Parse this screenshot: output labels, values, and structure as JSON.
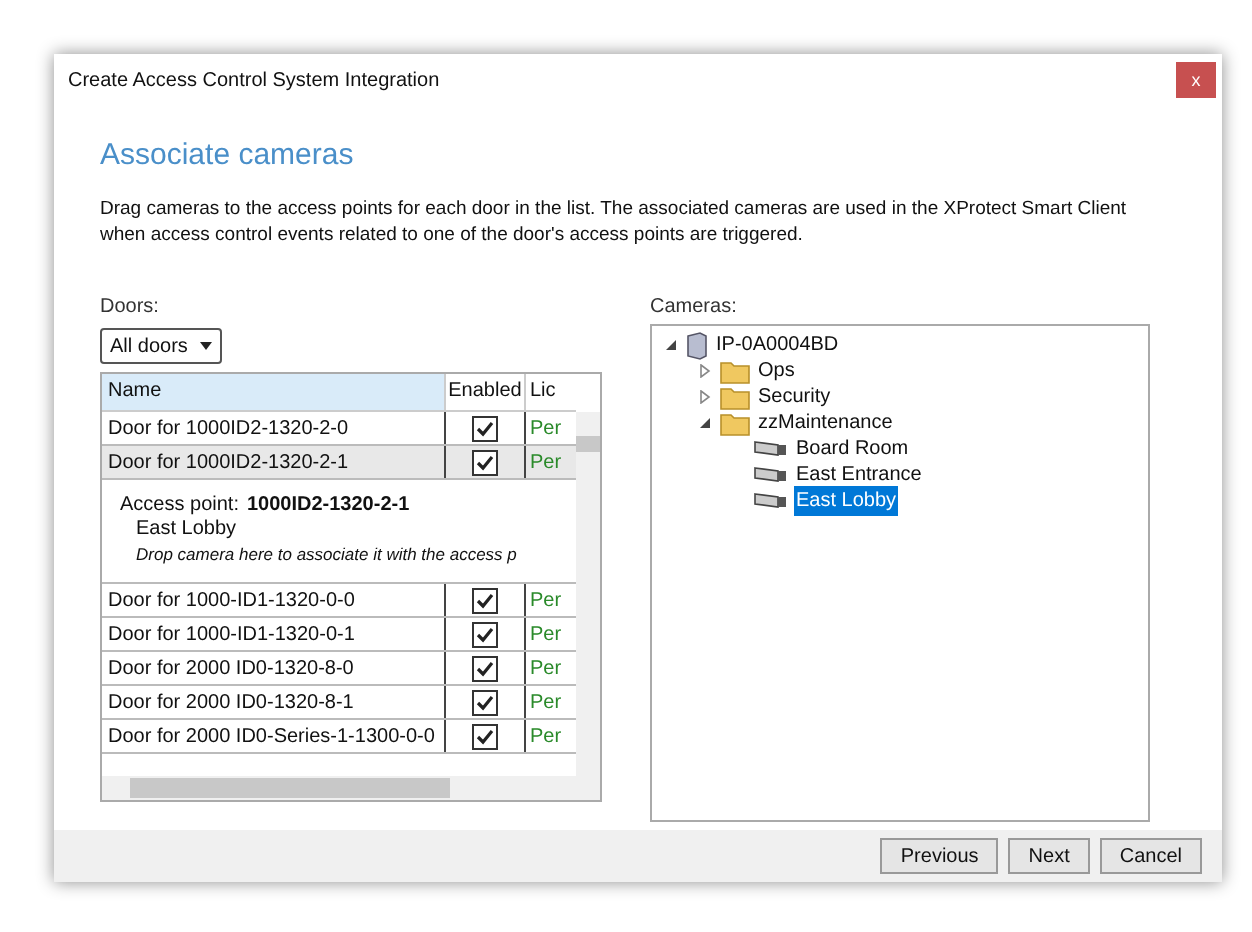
{
  "window": {
    "title": "Create Access Control System Integration",
    "close": "x"
  },
  "heading": "Associate cameras",
  "description": "Drag cameras to the access points for each door in the list. The associated cameras are used in the XProtect Smart Client when access control events related to one of the door's access points are triggered.",
  "doors": {
    "label": "Doors:",
    "filter": "All doors",
    "columns": [
      "Name",
      "Enabled",
      "Lic"
    ],
    "rows": [
      {
        "name": "Door for 1000ID2-1320-2-0",
        "enabled": true,
        "column_3": "Per",
        "selected": false
      },
      {
        "name": "Door for 1000ID2-1320-2-1",
        "enabled": true,
        "column_3": "Per",
        "selected": true,
        "detail": {
          "label": "Access point:",
          "access_point": "1000ID2-1320-2-1",
          "camera": "East Lobby",
          "hint": "Drop camera here to associate it with the access p"
        }
      },
      {
        "name": "Door for 1000-ID1-1320-0-0",
        "enabled": true,
        "column_3": "Per",
        "selected": false
      },
      {
        "name": "Door for 1000-ID1-1320-0-1",
        "enabled": true,
        "column_3": "Per",
        "selected": false
      },
      {
        "name": "Door for 2000 ID0-1320-8-0",
        "enabled": true,
        "column_3": "Per",
        "selected": false
      },
      {
        "name": "Door for 2000 ID0-1320-8-1",
        "enabled": true,
        "column_3": "Per",
        "selected": false
      },
      {
        "name": "Door for 2000 ID0-Series-1-1300-0-0",
        "enabled": true,
        "column_3": "Per",
        "selected": false
      }
    ]
  },
  "cameras": {
    "label": "Cameras:",
    "tree": [
      {
        "label": "IP-0A0004BD",
        "kind": "server",
        "expanded": true,
        "selected": false,
        "children": [
          {
            "label": "Ops",
            "kind": "folder",
            "expanded": false,
            "selected": false
          },
          {
            "label": "Security",
            "kind": "folder",
            "expanded": false,
            "selected": false
          },
          {
            "label": "zzMaintenance",
            "kind": "folder",
            "expanded": true,
            "selected": false,
            "children": [
              {
                "label": "Board Room",
                "kind": "camera",
                "selected": false
              },
              {
                "label": "East Entrance",
                "kind": "camera",
                "selected": false
              },
              {
                "label": "East Lobby",
                "kind": "camera",
                "selected": true
              }
            ]
          }
        ]
      }
    ]
  },
  "buttons": [
    "Previous",
    "Next",
    "Cancel"
  ]
}
